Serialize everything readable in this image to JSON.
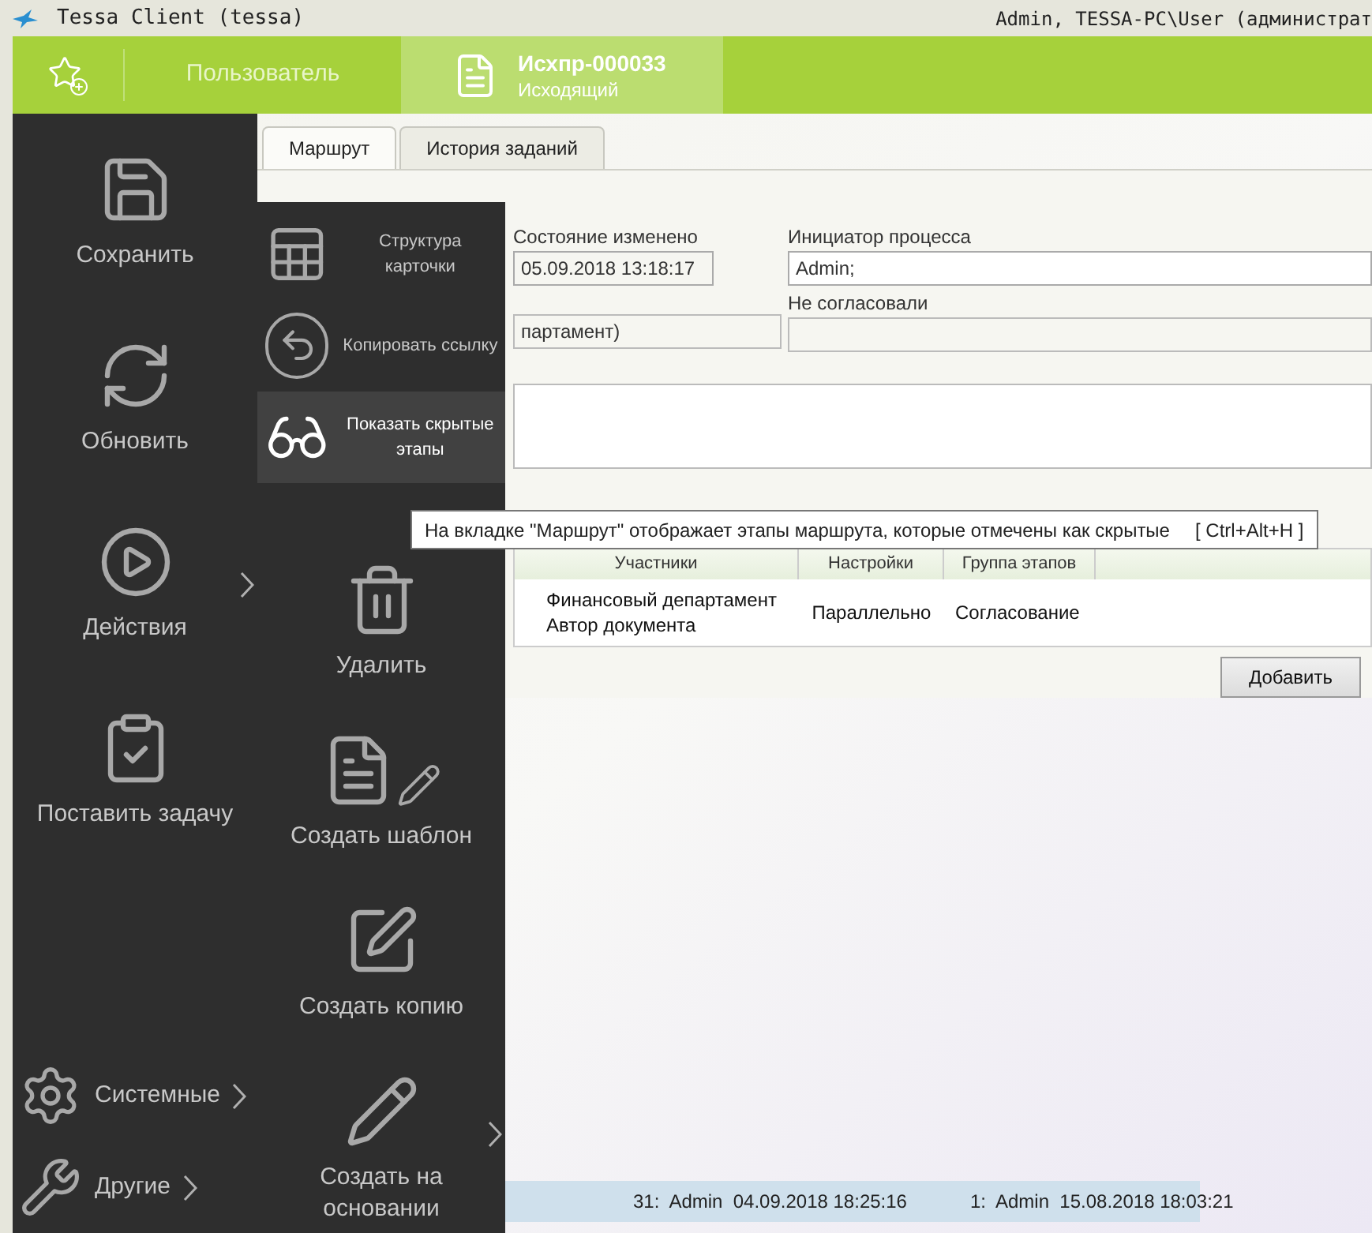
{
  "window": {
    "title": "Tessa Client (tessa)",
    "user": "Admin, TESSA-PC\\User (администрат"
  },
  "nav": {
    "user_tab": "Пользователь",
    "card_tab": {
      "title": "Исхпр-000033",
      "subtitle": "Исходящий",
      "selected": true
    }
  },
  "tabs": [
    {
      "label": "Маршрут",
      "selected": true
    },
    {
      "label": "История заданий",
      "selected": false
    }
  ],
  "state_changed": {
    "label": "Состояние изменено",
    "value": "05.09.2018  13:18:17"
  },
  "initiator": {
    "label": "Инициатор процесса",
    "value": "Admin;"
  },
  "approved_field": {
    "value": "партамент)"
  },
  "not_approved": {
    "label": "Не согласовали"
  },
  "tooltip": {
    "text": "На вкладке \"Маршрут\" отображает этапы маршрута, которые отмечены как скрытые",
    "shortcut": "[ Ctrl+Alt+H ]"
  },
  "stages_table": {
    "columns": [
      "Участники",
      "Настройки",
      "Группа этапов"
    ],
    "rows": [
      {
        "participants": [
          "Финансовый департамент",
          "Автор документа"
        ],
        "settings": "Параллельно",
        "group": "Согласование"
      }
    ]
  },
  "add_button": "Добавить",
  "status_bar": [
    "31:  Admin  04.09.2018 18:25:16",
    "1:  Admin  15.08.2018 18:03:21"
  ],
  "menu": {
    "main": [
      {
        "kind": "tile",
        "label": "Сохранить",
        "submenu": false,
        "selected": false
      },
      {
        "kind": "tile",
        "label": "Обновить",
        "submenu": false,
        "selected": false
      },
      {
        "kind": "tile",
        "label": "Действия",
        "submenu": true,
        "selected": false
      },
      {
        "kind": "tile",
        "label": "Поставить задачу",
        "submenu": false,
        "selected": false
      },
      {
        "kind": "row",
        "label": "Системные",
        "submenu": true,
        "selected": false
      },
      {
        "kind": "row",
        "label": "Другие",
        "submenu": true,
        "selected": false
      }
    ],
    "secondary": [
      {
        "kind": "small",
        "label": "Структура карточки",
        "submenu": false,
        "selected": false
      },
      {
        "kind": "small",
        "label": "Копировать ссылку",
        "submenu": false,
        "selected": false
      },
      {
        "kind": "small",
        "label": "Показать скрытые этапы",
        "submenu": false,
        "selected": true
      },
      {
        "kind": "tile",
        "label": "Удалить",
        "submenu": false,
        "selected": false
      },
      {
        "kind": "tile",
        "label": "Создать шаблон",
        "submenu": false,
        "selected": false
      },
      {
        "kind": "tile",
        "label": "Создать копию",
        "submenu": false,
        "selected": false
      },
      {
        "kind": "tile",
        "label": "Создать на основании",
        "submenu": true,
        "selected": false
      }
    ]
  }
}
